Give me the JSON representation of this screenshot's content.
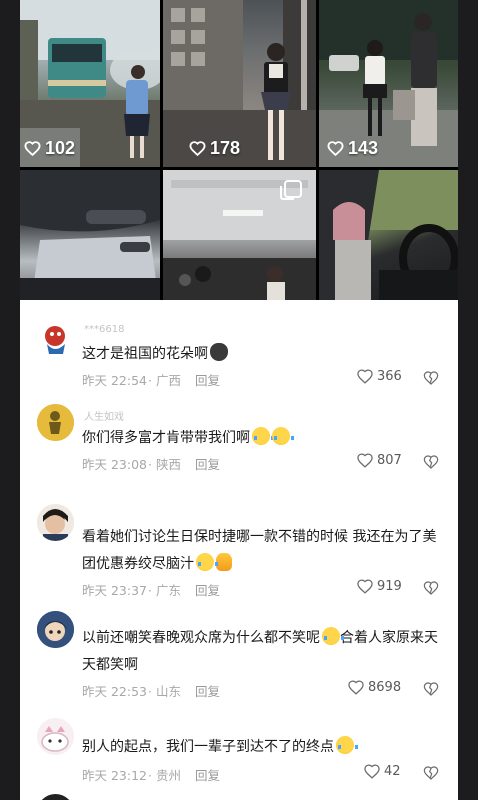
{
  "videos": [
    {
      "likes": "102",
      "scene": "train-platform-umbrella"
    },
    {
      "likes": "178",
      "scene": "street-uniform-girl"
    },
    {
      "likes": "143",
      "scene": "night-street-couple"
    },
    {
      "likes": "",
      "scene": "car-interior-roof"
    },
    {
      "likes": "",
      "scene": "bus-interior",
      "multi_image": true
    },
    {
      "likes": "",
      "scene": "girl-driving-car"
    }
  ],
  "comments": [
    {
      "username": "***6618",
      "text": "这才是祖国的花朵啊",
      "emoji": "cat-face",
      "time": "昨天 22:54",
      "location": "· 广西",
      "reply": "回复",
      "likes": "366"
    },
    {
      "username": "人生如戏",
      "text": "你们得多富才肯带带我们啊",
      "emoji": "crying-laughing x2",
      "time": "昨天 23:08",
      "location": "· 陕西",
      "reply": "回复",
      "likes": "807"
    },
    {
      "username": "",
      "text": "看着她们讨论生日保时捷哪一款不错的时候 我还在为了美团优惠券绞尽脑汁",
      "emoji": "crying-laughing, thumbs-up",
      "time": "昨天 23:37",
      "location": "· 广东",
      "reply": "回复",
      "likes": "919"
    },
    {
      "username": "",
      "text": "以前还嘲笑春晚观众席为什么都不笑呢",
      "text_b": "合着人家原来天天都笑啊",
      "emoji": "crying-laughing",
      "time": "昨天 22:53",
      "location": "· 山东",
      "reply": "回复",
      "likes": "8698"
    },
    {
      "username": "",
      "text": "别人的起点，我们一辈子到达不了的终点",
      "emoji": "crying-laughing",
      "time": "昨天 23:12",
      "location": "· 贵州",
      "reply": "回复",
      "likes": "42"
    }
  ]
}
